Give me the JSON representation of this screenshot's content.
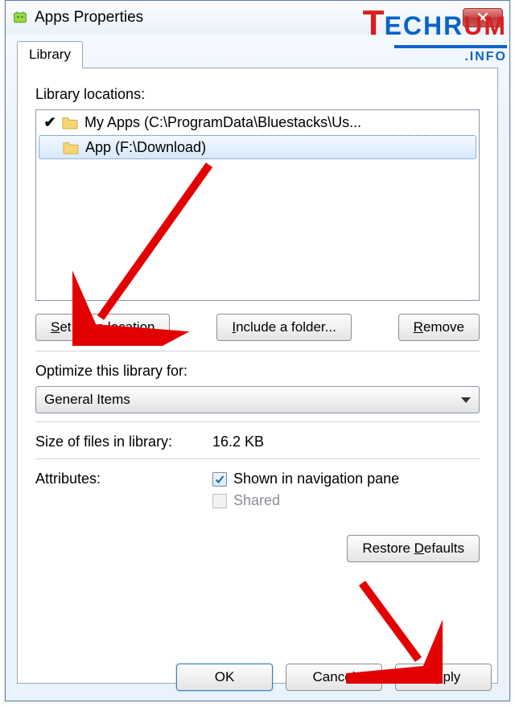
{
  "titlebar": {
    "title": "Apps Properties"
  },
  "tab": {
    "label": "Library"
  },
  "library": {
    "locations_label": "Library locations:",
    "items": [
      {
        "checked": "✔",
        "text": "My Apps (C:\\ProgramData\\Bluestacks\\Us..."
      },
      {
        "checked": "",
        "text": "App (F:\\Download)"
      }
    ],
    "buttons": {
      "set_save": "Set save location",
      "include": "Include a folder...",
      "remove": "Remove"
    }
  },
  "optimize": {
    "label": "Optimize this library for:",
    "selected": "General Items"
  },
  "size": {
    "label": "Size of files in library:",
    "value": "16.2 KB"
  },
  "attributes": {
    "label": "Attributes:",
    "navpane": "Shown in navigation pane",
    "shared": "Shared"
  },
  "restore_defaults": "Restore Defaults",
  "footer": {
    "ok": "OK",
    "cancel": "Cancel",
    "apply": "Apply"
  },
  "watermark": {
    "brand1": "T",
    "brand2": "ECHR",
    "brand3": "UM",
    "tag": ".INFO"
  }
}
